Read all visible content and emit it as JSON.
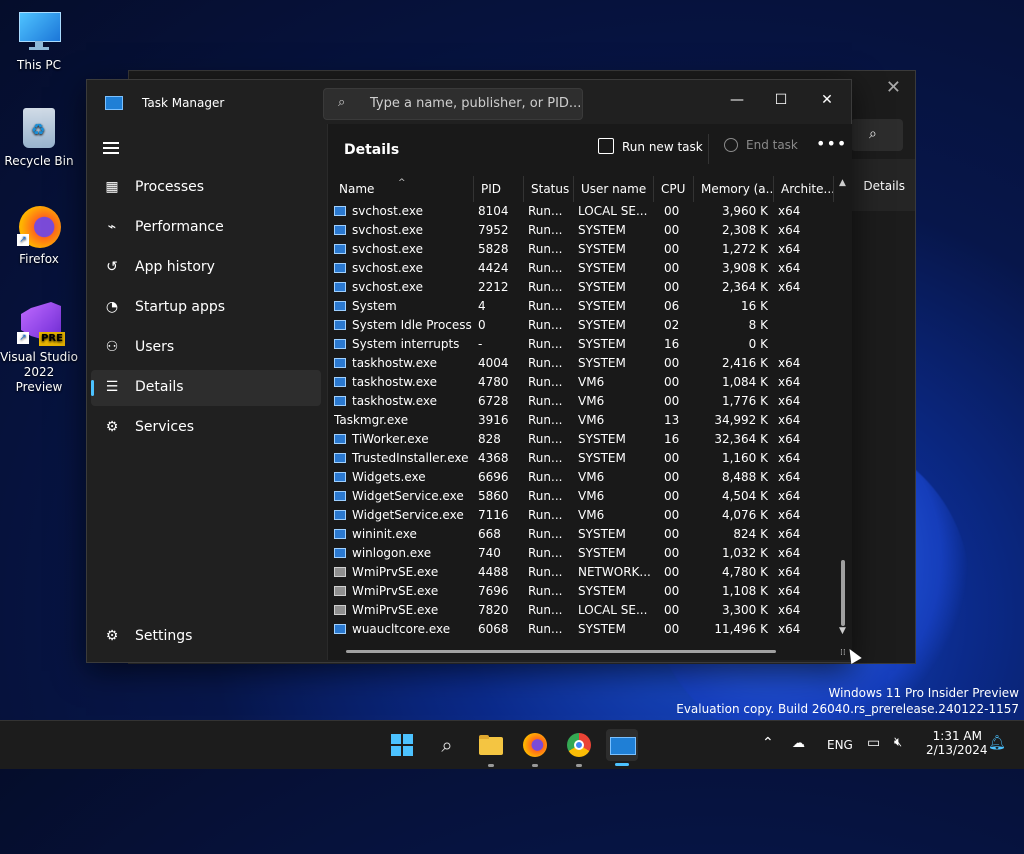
{
  "desktop": {
    "icons": [
      {
        "label": "This PC"
      },
      {
        "label": "Recycle Bin"
      },
      {
        "label": "Firefox"
      },
      {
        "label": "Visual Studio 2022 Preview",
        "badge": "PRE"
      }
    ]
  },
  "background_window": {
    "tab_label": "Details"
  },
  "task_manager": {
    "title": "Task Manager",
    "search_placeholder": "Type a name, publisher, or PID...",
    "nav": [
      {
        "label": "Processes",
        "icon": "processes-icon"
      },
      {
        "label": "Performance",
        "icon": "performance-icon"
      },
      {
        "label": "App history",
        "icon": "app-history-icon"
      },
      {
        "label": "Startup apps",
        "icon": "startup-apps-icon"
      },
      {
        "label": "Users",
        "icon": "users-icon"
      },
      {
        "label": "Details",
        "icon": "details-icon",
        "active": true
      },
      {
        "label": "Services",
        "icon": "services-icon"
      }
    ],
    "settings_label": "Settings",
    "page_title": "Details",
    "run_new_task": "Run new task",
    "end_task": "End task",
    "columns": [
      "Name",
      "PID",
      "Status",
      "User name",
      "CPU",
      "Memory (a...",
      "Archite..."
    ],
    "rows": [
      {
        "name": "svchost.exe",
        "pid": "8104",
        "status": "Run...",
        "user": "LOCAL SE...",
        "cpu": "00",
        "mem": "3,960 K",
        "arch": "x64",
        "icon": "app"
      },
      {
        "name": "svchost.exe",
        "pid": "7952",
        "status": "Run...",
        "user": "SYSTEM",
        "cpu": "00",
        "mem": "2,308 K",
        "arch": "x64",
        "icon": "app"
      },
      {
        "name": "svchost.exe",
        "pid": "5828",
        "status": "Run...",
        "user": "SYSTEM",
        "cpu": "00",
        "mem": "1,272 K",
        "arch": "x64",
        "icon": "app"
      },
      {
        "name": "svchost.exe",
        "pid": "4424",
        "status": "Run...",
        "user": "SYSTEM",
        "cpu": "00",
        "mem": "3,908 K",
        "arch": "x64",
        "icon": "app"
      },
      {
        "name": "svchost.exe",
        "pid": "2212",
        "status": "Run...",
        "user": "SYSTEM",
        "cpu": "00",
        "mem": "2,364 K",
        "arch": "x64",
        "icon": "app"
      },
      {
        "name": "System",
        "pid": "4",
        "status": "Run...",
        "user": "SYSTEM",
        "cpu": "06",
        "mem": "16 K",
        "arch": "",
        "icon": "app"
      },
      {
        "name": "System Idle Process",
        "pid": "0",
        "status": "Run...",
        "user": "SYSTEM",
        "cpu": "02",
        "mem": "8 K",
        "arch": "",
        "icon": "app"
      },
      {
        "name": "System interrupts",
        "pid": "-",
        "status": "Run...",
        "user": "SYSTEM",
        "cpu": "16",
        "mem": "0 K",
        "arch": "",
        "icon": "app"
      },
      {
        "name": "taskhostw.exe",
        "pid": "4004",
        "status": "Run...",
        "user": "SYSTEM",
        "cpu": "00",
        "mem": "2,416 K",
        "arch": "x64",
        "icon": "app"
      },
      {
        "name": "taskhostw.exe",
        "pid": "4780",
        "status": "Run...",
        "user": "VM6",
        "cpu": "00",
        "mem": "1,084 K",
        "arch": "x64",
        "icon": "app"
      },
      {
        "name": "taskhostw.exe",
        "pid": "6728",
        "status": "Run...",
        "user": "VM6",
        "cpu": "00",
        "mem": "1,776 K",
        "arch": "x64",
        "icon": "app"
      },
      {
        "name": "Taskmgr.exe",
        "pid": "3916",
        "status": "Run...",
        "user": "VM6",
        "cpu": "13",
        "mem": "34,992 K",
        "arch": "x64",
        "icon": "tm"
      },
      {
        "name": "TiWorker.exe",
        "pid": "828",
        "status": "Run...",
        "user": "SYSTEM",
        "cpu": "16",
        "mem": "32,364 K",
        "arch": "x64",
        "icon": "app"
      },
      {
        "name": "TrustedInstaller.exe",
        "pid": "4368",
        "status": "Run...",
        "user": "SYSTEM",
        "cpu": "00",
        "mem": "1,160 K",
        "arch": "x64",
        "icon": "app"
      },
      {
        "name": "Widgets.exe",
        "pid": "6696",
        "status": "Run...",
        "user": "VM6",
        "cpu": "00",
        "mem": "8,488 K",
        "arch": "x64",
        "icon": "app"
      },
      {
        "name": "WidgetService.exe",
        "pid": "5860",
        "status": "Run...",
        "user": "VM6",
        "cpu": "00",
        "mem": "4,504 K",
        "arch": "x64",
        "icon": "app"
      },
      {
        "name": "WidgetService.exe",
        "pid": "7116",
        "status": "Run...",
        "user": "VM6",
        "cpu": "00",
        "mem": "4,076 K",
        "arch": "x64",
        "icon": "app"
      },
      {
        "name": "wininit.exe",
        "pid": "668",
        "status": "Run...",
        "user": "SYSTEM",
        "cpu": "00",
        "mem": "824 K",
        "arch": "x64",
        "icon": "app"
      },
      {
        "name": "winlogon.exe",
        "pid": "740",
        "status": "Run...",
        "user": "SYSTEM",
        "cpu": "00",
        "mem": "1,032 K",
        "arch": "x64",
        "icon": "app"
      },
      {
        "name": "WmiPrvSE.exe",
        "pid": "4488",
        "status": "Run...",
        "user": "NETWORK...",
        "cpu": "00",
        "mem": "4,780 K",
        "arch": "x64",
        "icon": "gear"
      },
      {
        "name": "WmiPrvSE.exe",
        "pid": "7696",
        "status": "Run...",
        "user": "SYSTEM",
        "cpu": "00",
        "mem": "1,108 K",
        "arch": "x64",
        "icon": "gear"
      },
      {
        "name": "WmiPrvSE.exe",
        "pid": "7820",
        "status": "Run...",
        "user": "LOCAL SE...",
        "cpu": "00",
        "mem": "3,300 K",
        "arch": "x64",
        "icon": "gear"
      },
      {
        "name": "wuaucltcore.exe",
        "pid": "6068",
        "status": "Run...",
        "user": "SYSTEM",
        "cpu": "00",
        "mem": "11,496 K",
        "arch": "x64",
        "icon": "app"
      }
    ]
  },
  "watermark": {
    "line1": "Windows 11 Pro Insider Preview",
    "line2": "Evaluation copy. Build 26040.rs_prerelease.240122-1157"
  },
  "taskbar": {
    "language": "ENG",
    "time": "1:31 AM",
    "date": "2/13/2024"
  },
  "colors": {
    "accent": "#4cc2ff",
    "window_bg": "#202020",
    "content_bg": "#191919"
  }
}
